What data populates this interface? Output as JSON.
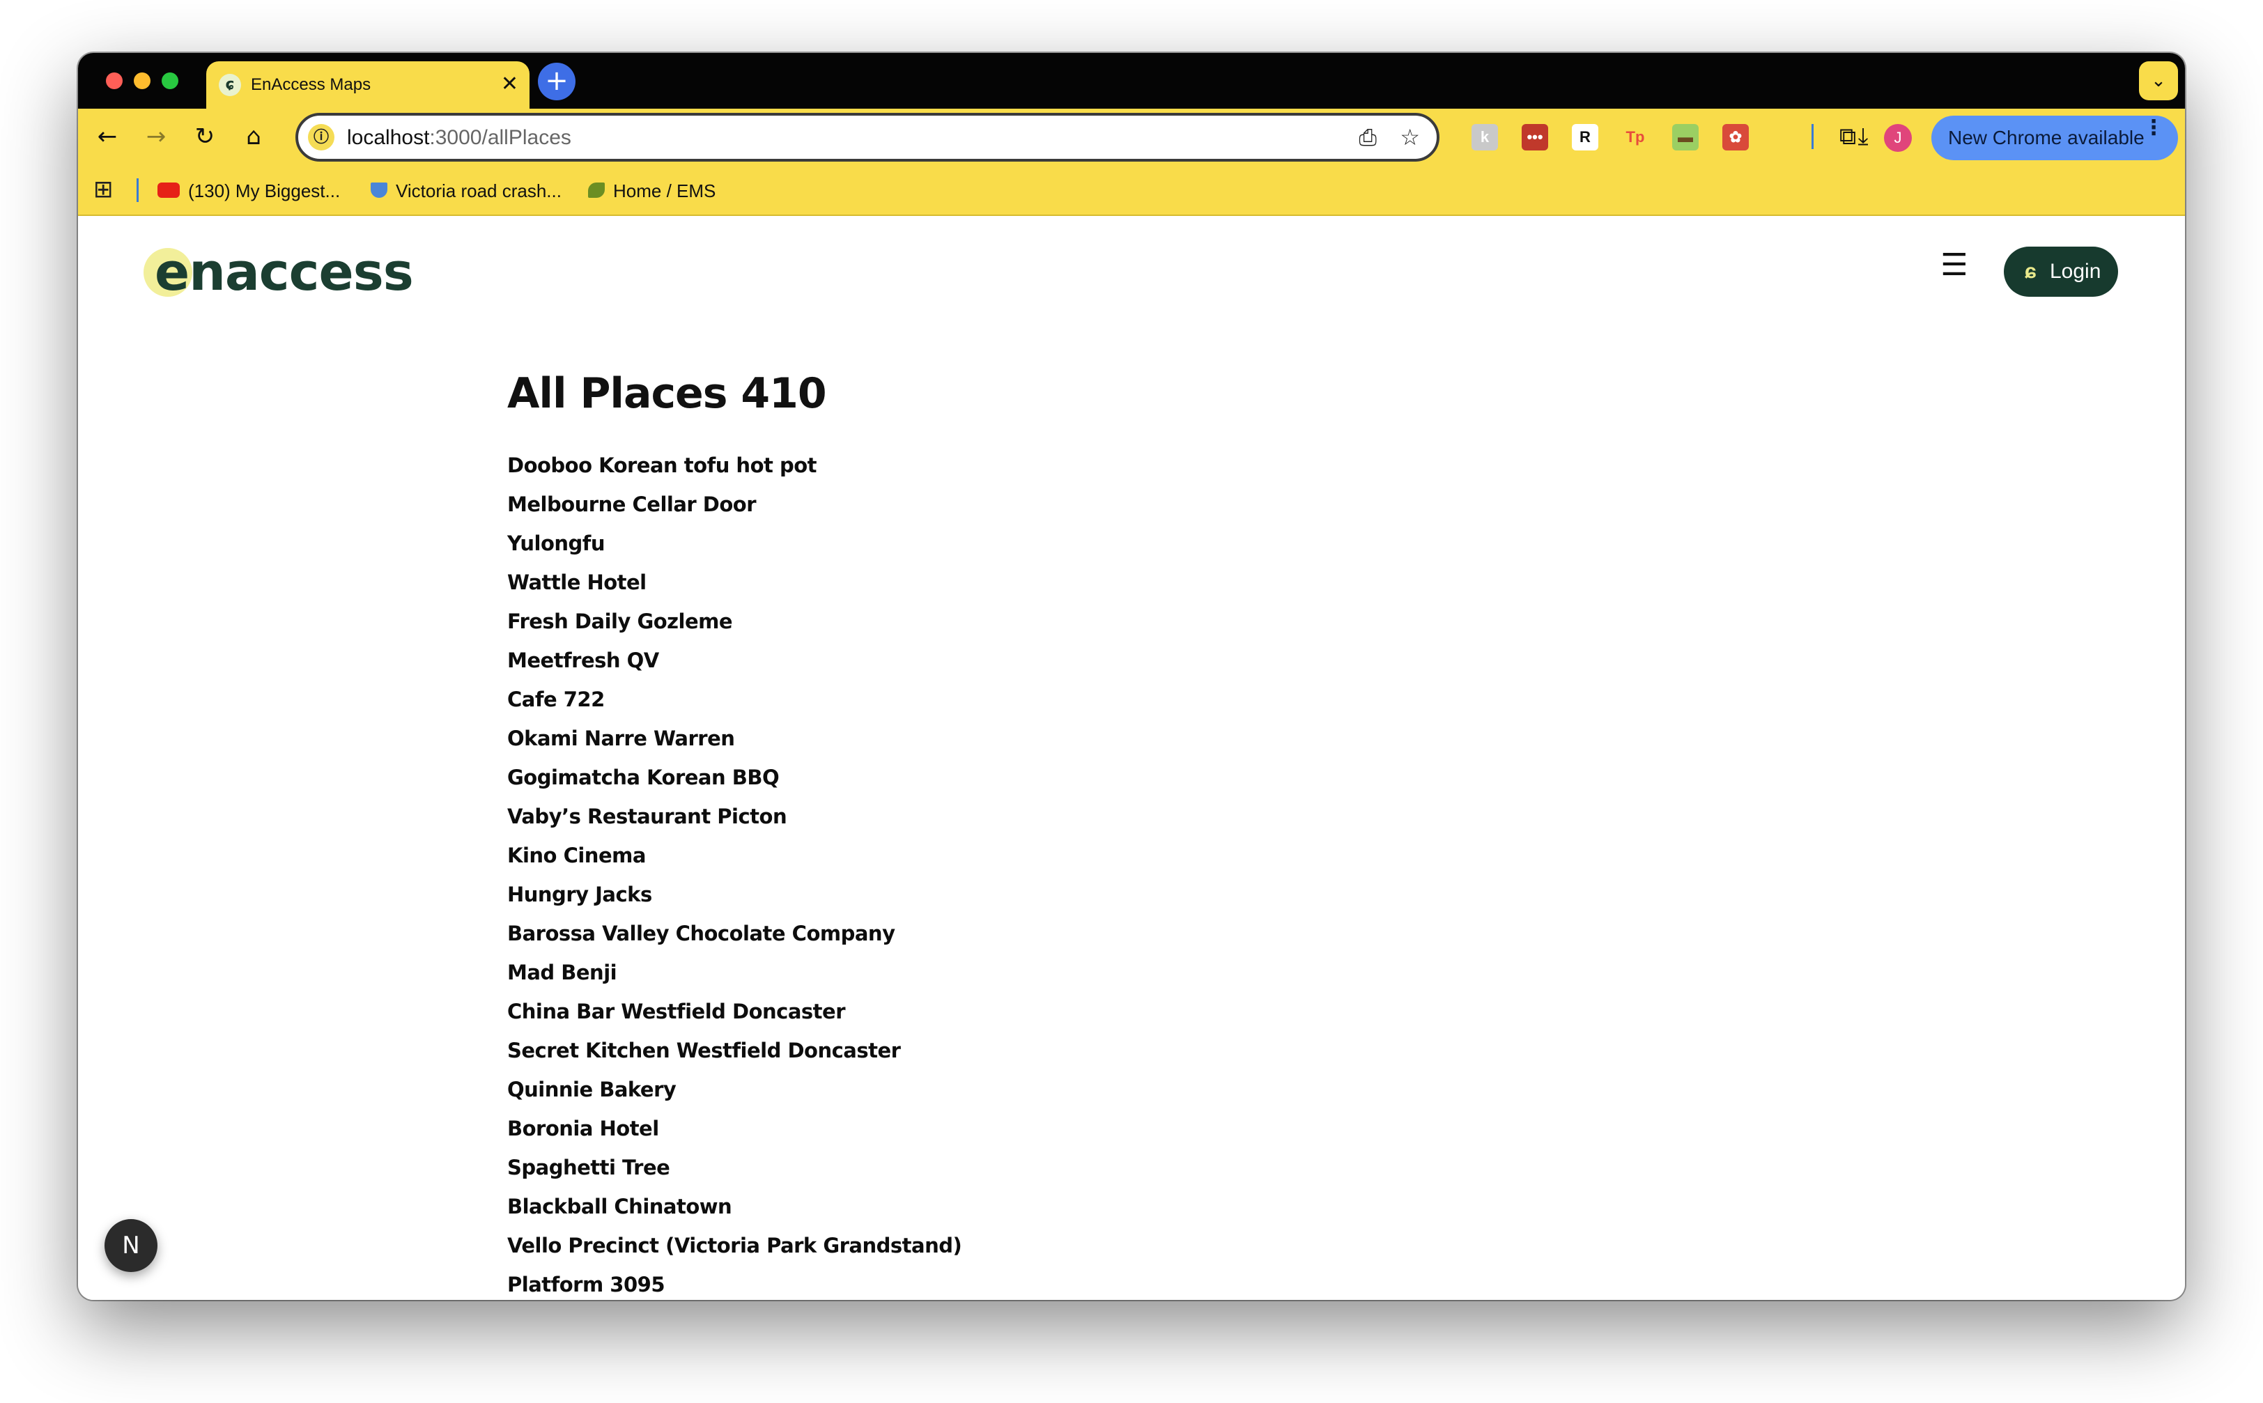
{
  "browser": {
    "tab_title": "EnAccess Maps",
    "tab_favicon": "ɕ",
    "tab_close": "✕",
    "new_tab": "+",
    "tab_search": "⌄",
    "url_host": "localhost",
    "url_path": ":3000/allPlaces",
    "site_info_icon": "ⓘ",
    "update_label": "New Chrome available",
    "update_more": "⋮",
    "profile_initial": "J",
    "bookmarks": [
      {
        "label": "(130) My Biggest...",
        "icon": "youtube-icon",
        "color": "#e62117"
      },
      {
        "label": "Victoria road crash...",
        "icon": "shield-icon",
        "color": "#4a86d8"
      },
      {
        "label": "Home / EMS",
        "icon": "leaf-icon",
        "color": "#6b8e23"
      }
    ],
    "extensions": [
      {
        "name": "extension-1-icon",
        "glyph": "k",
        "bg": "#c9c9c9",
        "fg": "#ffffff"
      },
      {
        "name": "extension-2-icon",
        "glyph": "•••",
        "bg": "#c0392b",
        "fg": "#ffffff"
      },
      {
        "name": "extension-3-icon",
        "glyph": "R",
        "bg": "#ffffff",
        "fg": "#111111"
      },
      {
        "name": "extension-4-icon",
        "glyph": "Tp",
        "bg": "#f9dc4a",
        "fg": "#e74c3c"
      },
      {
        "name": "extension-5-icon",
        "glyph": "▬",
        "bg": "#9bcf63",
        "fg": "#6b4b1f"
      },
      {
        "name": "extension-6-icon",
        "glyph": "✿",
        "bg": "#d94a3a",
        "fg": "#ffffff"
      }
    ]
  },
  "site": {
    "brand": "enaccess",
    "login_label": "Login",
    "login_icon": "ɕ",
    "menu_icon": "☰"
  },
  "main": {
    "title": "All Places 410",
    "places": [
      "Dooboo Korean tofu hot pot",
      "Melbourne Cellar Door",
      "Yulongfu",
      "Wattle Hotel",
      "Fresh Daily Gozleme",
      "Meetfresh QV",
      "Cafe 722",
      "Okami Narre Warren",
      "Gogimatcha Korean BBQ",
      "Vaby’s Restaurant Picton",
      "Kino Cinema",
      "Hungry Jacks",
      "Barossa Valley Chocolate Company",
      "Mad Benji",
      "China Bar Westfield Doncaster",
      "Secret Kitchen Westfield Doncaster",
      "Quinnie Bakery",
      "Boronia Hotel",
      "Spaghetti Tree",
      "Blackball Chinatown",
      "Vello Precinct (Victoria Park Grandstand)",
      "Platform 3095"
    ]
  },
  "dev_badge": "N"
}
